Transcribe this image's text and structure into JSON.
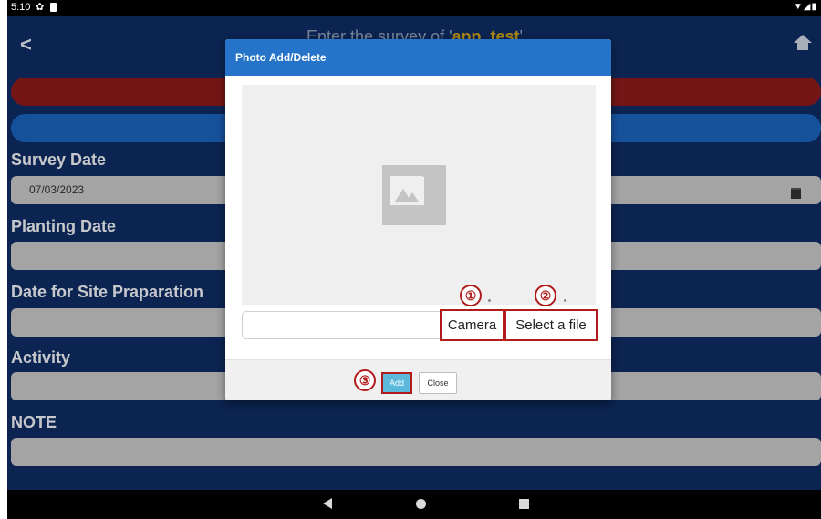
{
  "status_bar": {
    "time": "5:10",
    "gear_icon": "gear-icon",
    "signal": "▼◢▮"
  },
  "app_bar": {
    "title_prefix": "Enter the survey of '",
    "title_accent": "app_test",
    "title_suffix": "'",
    "back_icon": "chevron-left-icon",
    "home_icon": "home-icon"
  },
  "form": {
    "survey_date": {
      "label": "Survey Date",
      "value": "07/03/2023"
    },
    "planting_date": {
      "label": "Planting Date"
    },
    "site_preparation": {
      "label": "Date for Site Praparation"
    },
    "activity": {
      "label": "Activity"
    },
    "note": {
      "label": "NOTE"
    }
  },
  "modal": {
    "title": "Photo Add/Delete",
    "camera_label": "Camera",
    "select_file_label": "Select a file",
    "add_label": "Add",
    "close_label": "Close",
    "callouts": [
      "①",
      "②",
      "③"
    ]
  },
  "colors": {
    "accent": "#d0a51c",
    "header_blue": "#2673ca",
    "bg_navy": "#0f2d63",
    "red_bar": "#8f1b1b",
    "blue_bar": "#1c65bf",
    "highlight_red": "#b01b1b"
  }
}
